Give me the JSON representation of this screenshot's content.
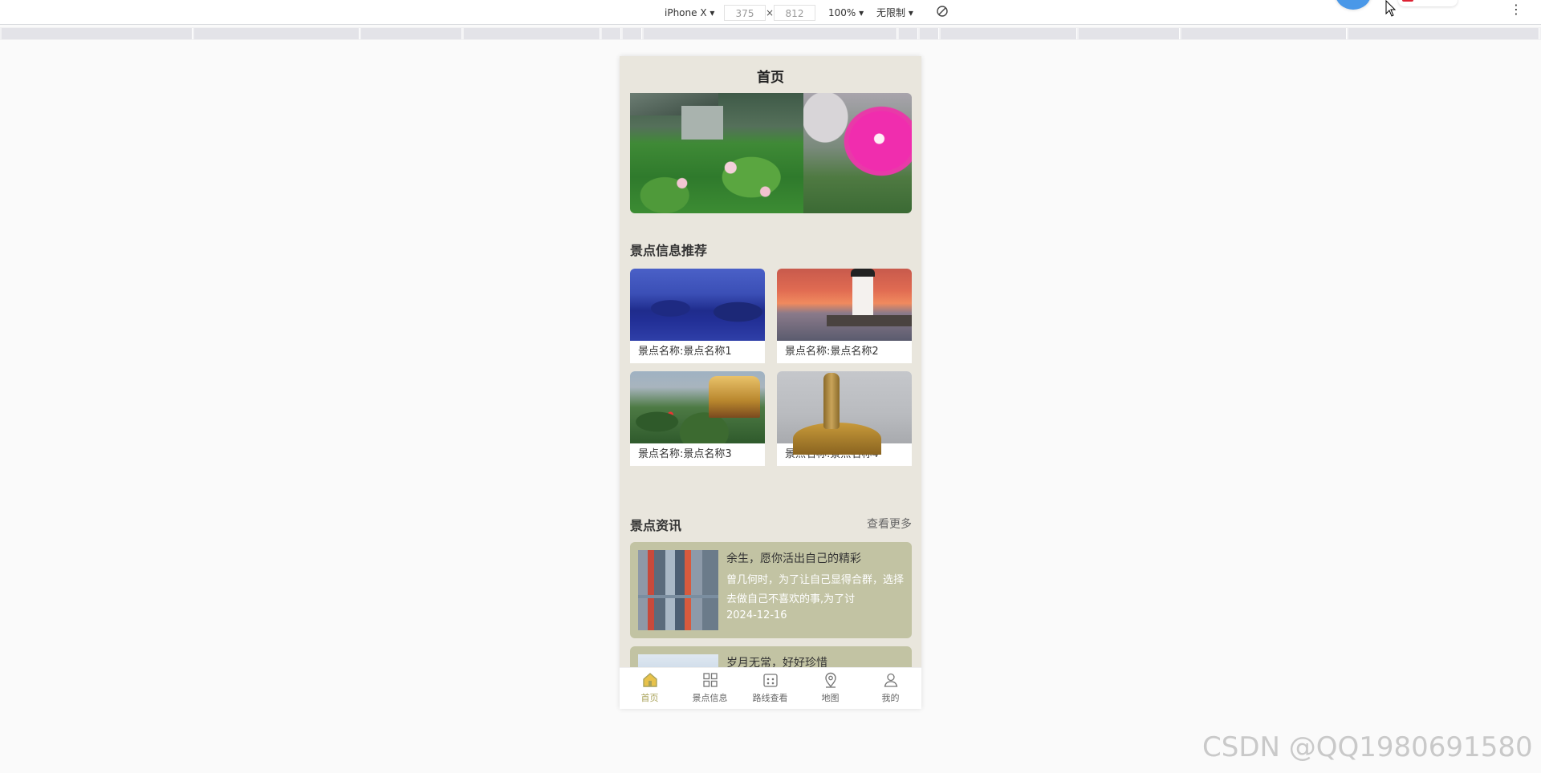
{
  "devtools": {
    "device": "iPhone X ▾",
    "width": "375",
    "times": "×",
    "height": "812",
    "zoom": "100% ▾",
    "throttle": "无限制 ▾",
    "more": "⋮"
  },
  "page": {
    "title": "首页",
    "section_attractions": "景点信息推荐",
    "section_news": "景点资讯",
    "more_link": "查看更多"
  },
  "attractions": [
    {
      "label": "景点名称:景点名称1"
    },
    {
      "label": "景点名称:景点名称2"
    },
    {
      "label": "景点名称:景点名称3"
    },
    {
      "label": "景点名称:景点名称4"
    }
  ],
  "news": [
    {
      "title": "余生，愿你活出自己的精彩",
      "summary": "曾几何时，为了让自己显得合群，选择去做自己不喜欢的事,为了讨",
      "date": "2024-12-16"
    },
    {
      "title": "岁月无常，好好珍惜",
      "summary": "",
      "date": ""
    }
  ],
  "tabbar": [
    {
      "label": "首页",
      "icon": "home-icon",
      "active": true
    },
    {
      "label": "景点信息",
      "icon": "grid-icon",
      "active": false
    },
    {
      "label": "路线查看",
      "icon": "route-icon",
      "active": false
    },
    {
      "label": "地图",
      "icon": "map-pin-icon",
      "active": false
    },
    {
      "label": "我的",
      "icon": "user-icon",
      "active": false
    }
  ],
  "colors": {
    "page_bg": "#e9e6dd",
    "news_card_bg": "#c2c3a3",
    "tab_active": "#a9a25a"
  },
  "watermark": "CSDN @QQ1980691580"
}
